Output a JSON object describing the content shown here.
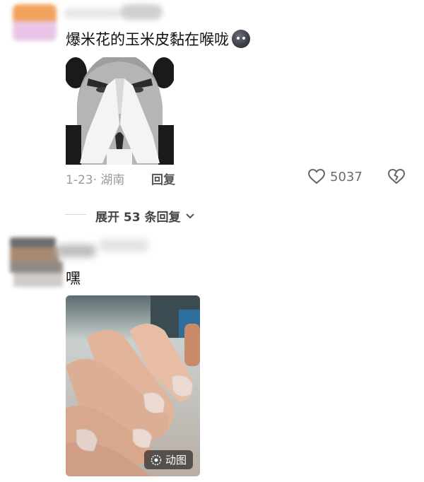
{
  "comments": [
    {
      "text": "爆米花的玉米皮黏在喉咙",
      "emoji_icon": "dark-sticker-emoji",
      "image_desc": "black-white-face-meme",
      "date": "1-23",
      "location": "湖南",
      "reply_label": "回复",
      "likes": "5037",
      "expand_label": "展开 53 条回复"
    },
    {
      "text": "嘿",
      "gif_label": "动图"
    }
  ],
  "colors": {
    "meta_gray": "#9a9a9a",
    "text_dark": "#111111"
  }
}
